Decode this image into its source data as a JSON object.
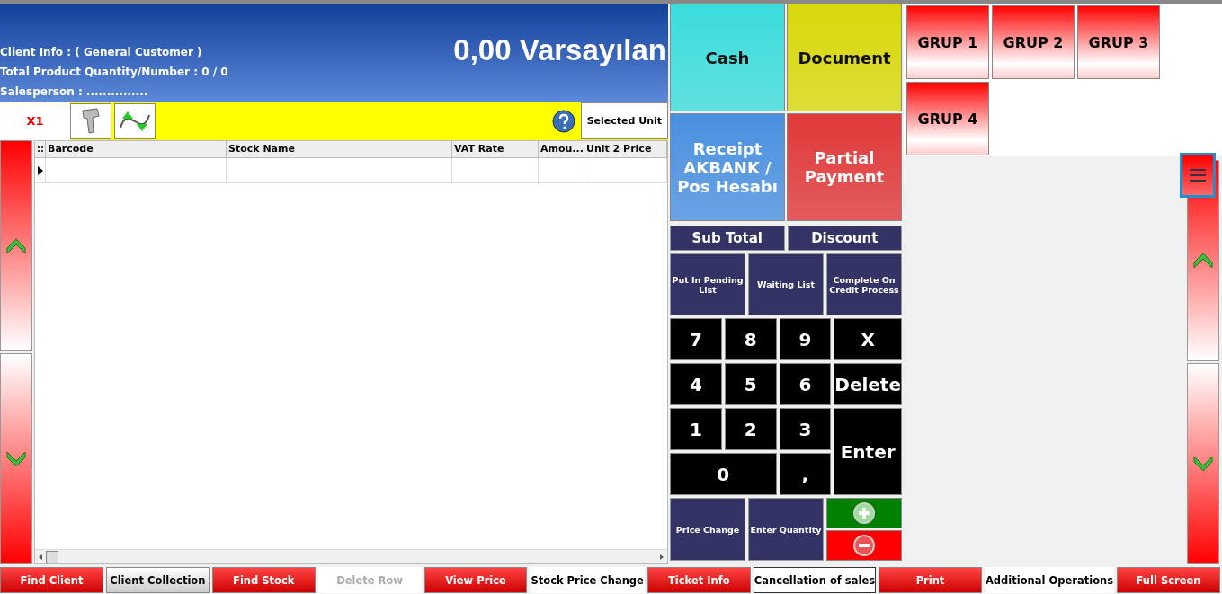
{
  "header": {
    "client_info": "Client Info : ( General Customer )",
    "quantity": "Total Product Quantity/Number : 0 / 0",
    "salesperson": "Salesperson : ...............",
    "total": "0,00 Varsayılan"
  },
  "toolbar": {
    "multiplier": "X1",
    "unit_button": "Selected Unit"
  },
  "table": {
    "columns": [
      "Barcode",
      "Stock Name",
      "VAT Rate",
      "Amou...",
      "Unit 2 Price"
    ]
  },
  "payments": [
    {
      "label": "Cash",
      "color": "#3cdcdc"
    },
    {
      "label": "Document",
      "color": "#d8d80a"
    },
    {
      "label": "Receipt AKBANK / Pos Hesabı",
      "color": "#4a90e0"
    },
    {
      "label": "Partial Payment",
      "color": "#e03838"
    }
  ],
  "totals": [
    "Sub Total",
    "Discount"
  ],
  "actions": [
    "Put In Pending List",
    "Waiting List",
    "Complete On Credit Process"
  ],
  "keypad": [
    {
      "label": "7",
      "kind": "digit"
    },
    {
      "label": "8",
      "kind": "digit"
    },
    {
      "label": "9",
      "kind": "digit"
    },
    {
      "label": "X",
      "kind": "digit"
    },
    {
      "label": "4",
      "kind": "digit"
    },
    {
      "label": "5",
      "kind": "digit"
    },
    {
      "label": "6",
      "kind": "digit"
    },
    {
      "label": "Delete",
      "kind": "digit"
    },
    {
      "label": "1",
      "kind": "digit"
    },
    {
      "label": "2",
      "kind": "digit"
    },
    {
      "label": "3",
      "kind": "digit"
    },
    {
      "label": "Enter",
      "kind": "tall"
    },
    {
      "label": "0",
      "kind": "wide"
    },
    {
      "label": ",",
      "kind": "digit"
    }
  ],
  "bottom_actions": [
    "Price Change",
    "Enter Quantity"
  ],
  "groups": [
    "GRUP 1",
    "GRUP 2",
    "GRUP 3",
    "GRUP 4"
  ],
  "footer": [
    {
      "label": "Find Client",
      "kind": "red"
    },
    {
      "label": "Client Collection",
      "kind": "grey"
    },
    {
      "label": "Find Stock",
      "kind": "red"
    },
    {
      "label": "Delete Row",
      "kind": "disabled"
    },
    {
      "label": "View Price",
      "kind": "red"
    },
    {
      "label": "Stock Price Change",
      "kind": "plain"
    },
    {
      "label": "Ticket Info",
      "kind": "red"
    },
    {
      "label": "Cancellation of sales",
      "kind": "outlined"
    },
    {
      "label": "Print",
      "kind": "red"
    },
    {
      "label": "Additional Operations",
      "kind": "plain"
    },
    {
      "label": "Full Screen",
      "kind": "red"
    }
  ]
}
